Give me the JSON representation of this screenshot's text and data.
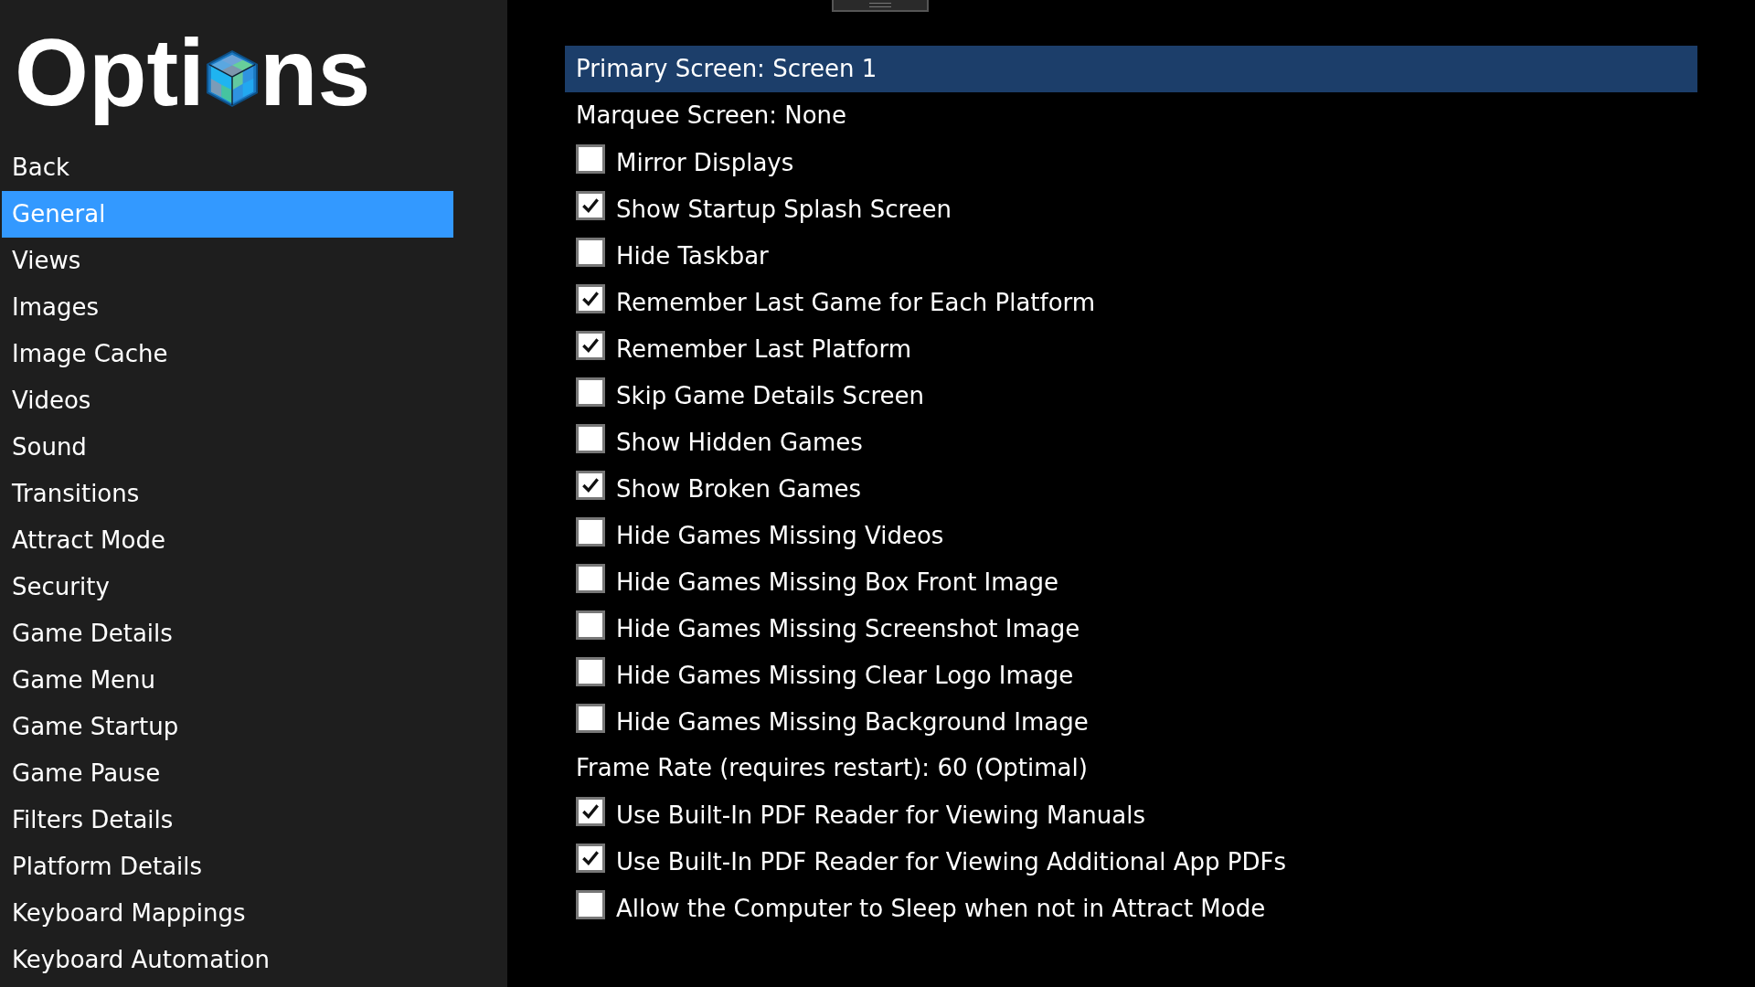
{
  "logo": {
    "text_before": "Opti",
    "text_after": "ns"
  },
  "sidebar": {
    "items": [
      {
        "label": "Back",
        "selected": false
      },
      {
        "label": "General",
        "selected": true
      },
      {
        "label": "Views",
        "selected": false
      },
      {
        "label": "Images",
        "selected": false
      },
      {
        "label": "Image Cache",
        "selected": false
      },
      {
        "label": "Videos",
        "selected": false
      },
      {
        "label": "Sound",
        "selected": false
      },
      {
        "label": "Transitions",
        "selected": false
      },
      {
        "label": "Attract Mode",
        "selected": false
      },
      {
        "label": "Security",
        "selected": false
      },
      {
        "label": "Game Details",
        "selected": false
      },
      {
        "label": "Game Menu",
        "selected": false
      },
      {
        "label": "Game Startup",
        "selected": false
      },
      {
        "label": "Game Pause",
        "selected": false
      },
      {
        "label": "Filters Details",
        "selected": false
      },
      {
        "label": "Platform Details",
        "selected": false
      },
      {
        "label": "Keyboard Mappings",
        "selected": false
      },
      {
        "label": "Keyboard Automation",
        "selected": false
      }
    ]
  },
  "settings": [
    {
      "kind": "value",
      "label": "Primary Screen: Screen 1",
      "selected": true
    },
    {
      "kind": "value",
      "label": "Marquee Screen: None",
      "selected": false
    },
    {
      "kind": "checkbox",
      "label": "Mirror Displays",
      "checked": false,
      "selected": false
    },
    {
      "kind": "checkbox",
      "label": "Show Startup Splash Screen",
      "checked": true,
      "selected": false
    },
    {
      "kind": "checkbox",
      "label": "Hide Taskbar",
      "checked": false,
      "selected": false
    },
    {
      "kind": "checkbox",
      "label": "Remember Last Game for Each Platform",
      "checked": true,
      "selected": false
    },
    {
      "kind": "checkbox",
      "label": "Remember Last Platform",
      "checked": true,
      "selected": false
    },
    {
      "kind": "checkbox",
      "label": "Skip Game Details Screen",
      "checked": false,
      "selected": false
    },
    {
      "kind": "checkbox",
      "label": "Show Hidden Games",
      "checked": false,
      "selected": false
    },
    {
      "kind": "checkbox",
      "label": "Show Broken Games",
      "checked": true,
      "selected": false
    },
    {
      "kind": "checkbox",
      "label": "Hide Games Missing Videos",
      "checked": false,
      "selected": false
    },
    {
      "kind": "checkbox",
      "label": "Hide Games Missing Box Front Image",
      "checked": false,
      "selected": false
    },
    {
      "kind": "checkbox",
      "label": "Hide Games Missing Screenshot Image",
      "checked": false,
      "selected": false
    },
    {
      "kind": "checkbox",
      "label": "Hide Games Missing Clear Logo Image",
      "checked": false,
      "selected": false
    },
    {
      "kind": "checkbox",
      "label": "Hide Games Missing Background Image",
      "checked": false,
      "selected": false
    },
    {
      "kind": "value",
      "label": "Frame Rate (requires restart): 60 (Optimal)",
      "selected": false
    },
    {
      "kind": "checkbox",
      "label": "Use Built-In PDF Reader for Viewing Manuals",
      "checked": true,
      "selected": false
    },
    {
      "kind": "checkbox",
      "label": "Use Built-In PDF Reader for Viewing Additional App PDFs",
      "checked": true,
      "selected": false
    },
    {
      "kind": "checkbox",
      "label": "Allow the Computer to Sleep when not in Attract Mode",
      "checked": false,
      "selected": false
    }
  ]
}
